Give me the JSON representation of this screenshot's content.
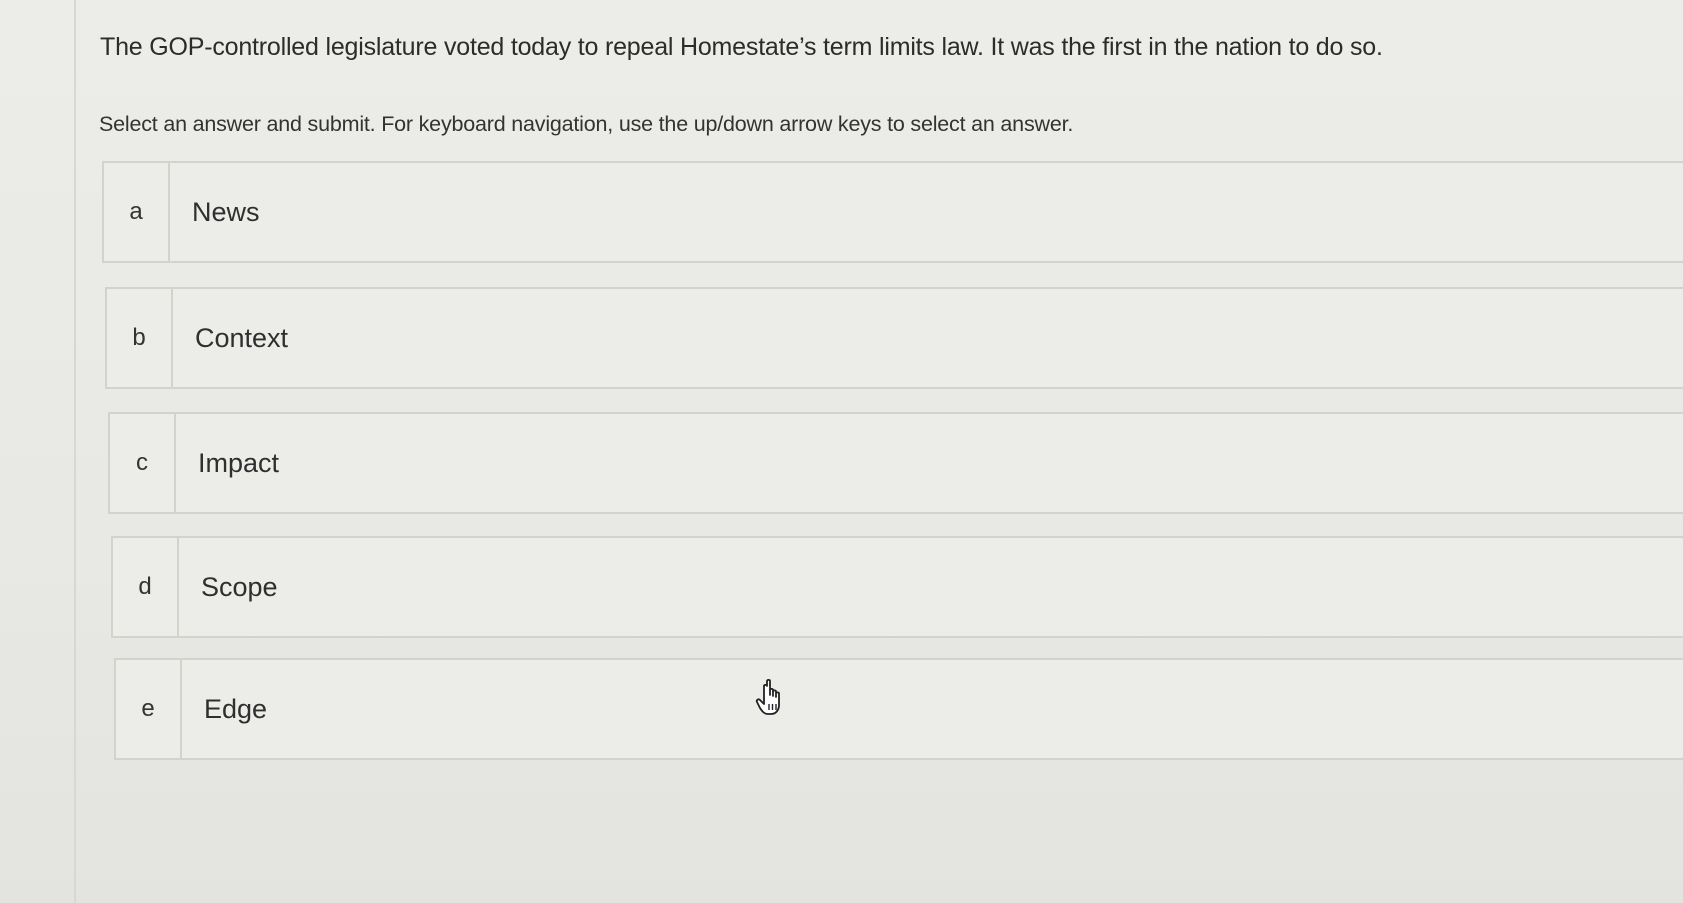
{
  "question": {
    "text": "The GOP-controlled legislature voted today to repeal Homestate’s term limits law. It was the first in the nation to do so."
  },
  "instructions": {
    "text": "Select an answer and submit. For keyboard navigation, use the up/down arrow keys to select an answer."
  },
  "options": [
    {
      "letter": "a",
      "label": "News"
    },
    {
      "letter": "b",
      "label": "Context"
    },
    {
      "letter": "c",
      "label": "Impact"
    },
    {
      "letter": "d",
      "label": "Scope"
    },
    {
      "letter": "e",
      "label": "Edge"
    }
  ],
  "cursor": {
    "icon": "hand-pointer-icon"
  }
}
